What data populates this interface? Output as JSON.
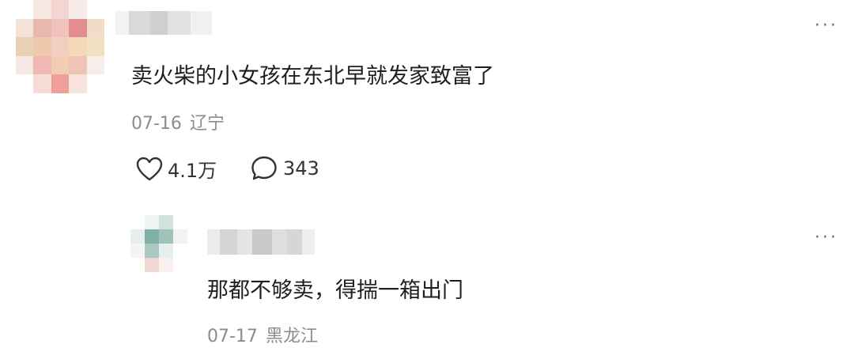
{
  "main_comment": {
    "text": "卖火柴的小女孩在东北早就发家致富了",
    "date": "07-16",
    "location": "辽宁",
    "likes": "4.1万",
    "replies": "343",
    "more_label": "···",
    "avatar_icon": "blurred-avatar",
    "username_state": "pixelated"
  },
  "reply_comment": {
    "text": "那都不够卖，得揣一箱出门",
    "date": "07-17",
    "location": "黑龙江",
    "more_label": "···",
    "avatar_icon": "blurred-avatar",
    "username_state": "pixelated"
  },
  "colors": {
    "text": "#1e1e1e",
    "meta": "#8c8c8c",
    "icon": "#333333"
  }
}
